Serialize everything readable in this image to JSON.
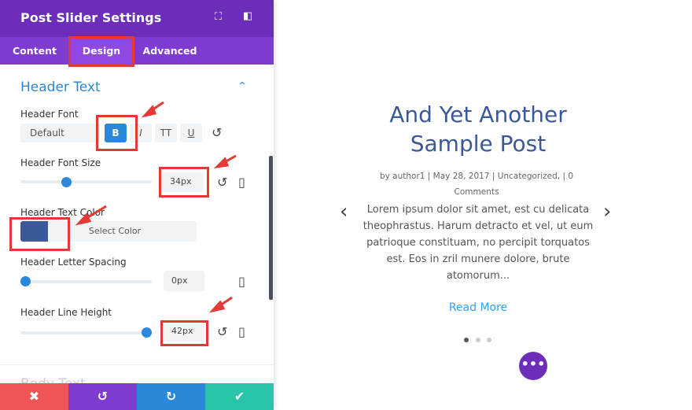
{
  "panel": {
    "title": "Post Slider Settings",
    "tabs": [
      {
        "label": "Content"
      },
      {
        "label": "Design"
      },
      {
        "label": "Advanced"
      }
    ],
    "section_title": "Header Text",
    "header_font": {
      "label": "Header Font",
      "value": "Default",
      "bold": "B",
      "italic": "I",
      "uppercase": "TT",
      "underline": "U"
    },
    "font_size": {
      "label": "Header Font Size",
      "value": "34px",
      "slider_percent": 30
    },
    "text_color": {
      "label": "Header Text Color",
      "color": "#3b5998",
      "button": "Select Color"
    },
    "letter_spacing": {
      "label": "Header Letter Spacing",
      "value": "0px",
      "slider_percent": 0
    },
    "line_height": {
      "label": "Header Line Height",
      "value": "42px",
      "slider_percent": 95
    },
    "next_section": "Body Text"
  },
  "colors": {
    "header": "#6c2eb9",
    "tabs": "#7e3bd0",
    "accent": "#2b87da",
    "cancel": "#ef5555",
    "undo": "#7e3bd0",
    "redo": "#2b87da",
    "save": "#29c4a9"
  },
  "slide": {
    "title": "And Yet Another Sample Post",
    "meta": "by author1 | May 28, 2017 | Uncategorized, | 0 Comments",
    "excerpt": "Lorem ipsum dolor sit amet, est cu delicata theophrastus. Harum detracto et vel, ut eum patrioque constituam, no percipit torquatos est. Eos in zril munere dolore, brute atomorum...",
    "read_more": "Read More",
    "active_dot": 1,
    "dot_count": 3
  }
}
